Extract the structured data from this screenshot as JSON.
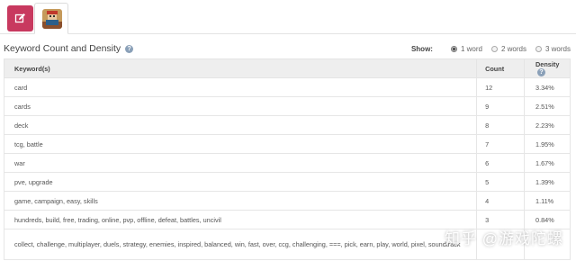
{
  "tabs": {
    "edit_icon": "edit-icon",
    "app_icon": "app-thumbnail"
  },
  "section": {
    "title": "Keyword Count and Density"
  },
  "show": {
    "label": "Show:",
    "options": [
      "1 word",
      "2 words",
      "3 words"
    ],
    "selected": "1 word"
  },
  "table": {
    "headers": {
      "keyword": "Keyword(s)",
      "count": "Count",
      "density": "Density"
    },
    "rows": [
      {
        "keyword": "card",
        "count": "12",
        "density": "3.34%"
      },
      {
        "keyword": "cards",
        "count": "9",
        "density": "2.51%"
      },
      {
        "keyword": "deck",
        "count": "8",
        "density": "2.23%"
      },
      {
        "keyword": "tcg, battle",
        "count": "7",
        "density": "1.95%"
      },
      {
        "keyword": "war",
        "count": "6",
        "density": "1.67%"
      },
      {
        "keyword": "pve, upgrade",
        "count": "5",
        "density": "1.39%"
      },
      {
        "keyword": "game, campaign, easy, skills",
        "count": "4",
        "density": "1.11%"
      },
      {
        "keyword": "hundreds, build, free, trading, online, pvp, offline, defeat, battles, uncivil",
        "count": "3",
        "density": "0.84%"
      },
      {
        "keyword": "collect, challenge, multiplayer, duels, strategy, enemies, inspired, balanced, win, fast, over, ccg, challenging, ===, pick, earn, play, world, pixel, soundtrack",
        "count": "",
        "density": ""
      }
    ]
  },
  "watermark": {
    "text": "知乎 @游戏陀螺"
  },
  "colors": {
    "edit_tab": "#c8395f",
    "header_bg": "#eeeeee"
  }
}
